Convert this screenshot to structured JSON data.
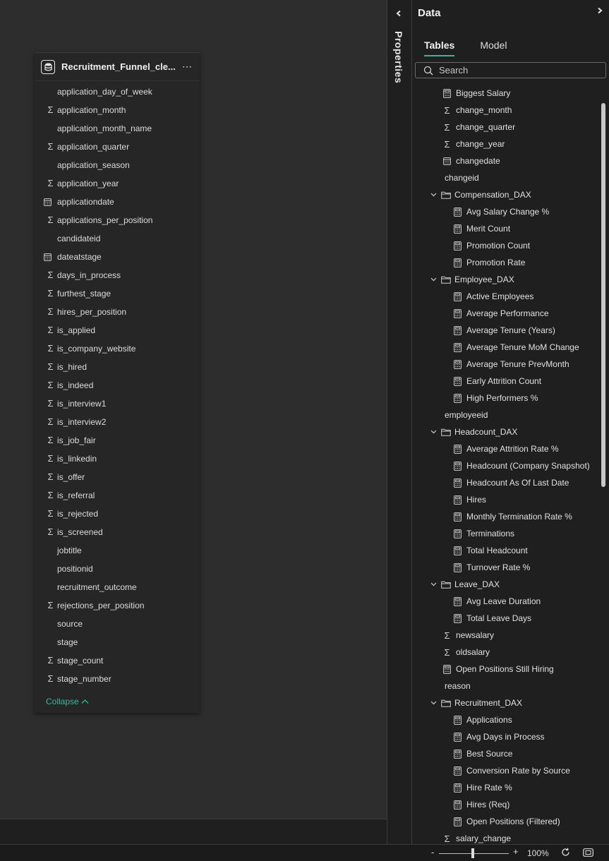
{
  "card": {
    "title": "Recruitment_Funnel_cle...",
    "more": "⋯",
    "collapse_label": "Collapse",
    "fields": [
      {
        "icon": "",
        "label": "application_day_of_week"
      },
      {
        "icon": "sigma",
        "label": "application_month"
      },
      {
        "icon": "",
        "label": "application_month_name"
      },
      {
        "icon": "sigma",
        "label": "application_quarter"
      },
      {
        "icon": "",
        "label": "application_season"
      },
      {
        "icon": "sigma",
        "label": "application_year"
      },
      {
        "icon": "calendar",
        "label": "applicationdate"
      },
      {
        "icon": "sigma",
        "label": "applications_per_position"
      },
      {
        "icon": "",
        "label": "candidateid"
      },
      {
        "icon": "calendar",
        "label": "dateatstage"
      },
      {
        "icon": "sigma",
        "label": "days_in_process"
      },
      {
        "icon": "sigma",
        "label": "furthest_stage"
      },
      {
        "icon": "sigma",
        "label": "hires_per_position"
      },
      {
        "icon": "sigma",
        "label": "is_applied"
      },
      {
        "icon": "sigma",
        "label": "is_company_website"
      },
      {
        "icon": "sigma",
        "label": "is_hired"
      },
      {
        "icon": "sigma",
        "label": "is_indeed"
      },
      {
        "icon": "sigma",
        "label": "is_interview1"
      },
      {
        "icon": "sigma",
        "label": "is_interview2"
      },
      {
        "icon": "sigma",
        "label": "is_job_fair"
      },
      {
        "icon": "sigma",
        "label": "is_linkedin"
      },
      {
        "icon": "sigma",
        "label": "is_offer"
      },
      {
        "icon": "sigma",
        "label": "is_referral"
      },
      {
        "icon": "sigma",
        "label": "is_rejected"
      },
      {
        "icon": "sigma",
        "label": "is_screened"
      },
      {
        "icon": "",
        "label": "jobtitle"
      },
      {
        "icon": "",
        "label": "positionid"
      },
      {
        "icon": "",
        "label": "recruitment_outcome"
      },
      {
        "icon": "sigma",
        "label": "rejections_per_position"
      },
      {
        "icon": "",
        "label": "source"
      },
      {
        "icon": "",
        "label": "stage"
      },
      {
        "icon": "sigma",
        "label": "stage_count"
      },
      {
        "icon": "sigma",
        "label": "stage_number"
      }
    ]
  },
  "properties": {
    "label": "Properties"
  },
  "data_pane": {
    "title": "Data",
    "tabs": [
      "Tables",
      "Model"
    ],
    "active_tab": "Tables",
    "search_placeholder": "Search",
    "tree": [
      {
        "level": 1,
        "folder": false,
        "icon": "calculator",
        "label": "Biggest Salary"
      },
      {
        "level": 1,
        "folder": false,
        "icon": "sigma",
        "label": "change_month"
      },
      {
        "level": 1,
        "folder": false,
        "icon": "sigma",
        "label": "change_quarter"
      },
      {
        "level": 1,
        "folder": false,
        "icon": "sigma",
        "label": "change_year"
      },
      {
        "level": 1,
        "folder": false,
        "icon": "calendar",
        "label": "changedate"
      },
      {
        "level": 1,
        "folder": false,
        "icon": "",
        "label": "changeid"
      },
      {
        "level": 1,
        "folder": true,
        "icon": "folder",
        "label": "Compensation_DAX"
      },
      {
        "level": 2,
        "folder": false,
        "icon": "calculator",
        "label": "Avg Salary Change %"
      },
      {
        "level": 2,
        "folder": false,
        "icon": "calculator",
        "label": "Merit Count"
      },
      {
        "level": 2,
        "folder": false,
        "icon": "calculator",
        "label": "Promotion Count"
      },
      {
        "level": 2,
        "folder": false,
        "icon": "calculator",
        "label": "Promotion Rate"
      },
      {
        "level": 1,
        "folder": true,
        "icon": "folder",
        "label": "Employee_DAX"
      },
      {
        "level": 2,
        "folder": false,
        "icon": "calculator",
        "label": "Active Employees"
      },
      {
        "level": 2,
        "folder": false,
        "icon": "calculator",
        "label": "Average Performance"
      },
      {
        "level": 2,
        "folder": false,
        "icon": "calculator",
        "label": "Average Tenure (Years)"
      },
      {
        "level": 2,
        "folder": false,
        "icon": "calculator",
        "label": "Average Tenure MoM Change"
      },
      {
        "level": 2,
        "folder": false,
        "icon": "calculator",
        "label": "Average Tenure PrevMonth"
      },
      {
        "level": 2,
        "folder": false,
        "icon": "calculator",
        "label": "Early Attrition Count"
      },
      {
        "level": 2,
        "folder": false,
        "icon": "calculator",
        "label": "High Performers %"
      },
      {
        "level": 1,
        "folder": false,
        "icon": "",
        "label": "employeeid"
      },
      {
        "level": 1,
        "folder": true,
        "icon": "folder",
        "label": "Headcount_DAX"
      },
      {
        "level": 2,
        "folder": false,
        "icon": "calculator",
        "label": "Average Attrition Rate %"
      },
      {
        "level": 2,
        "folder": false,
        "icon": "calculator",
        "label": "Headcount (Company Snapshot)"
      },
      {
        "level": 2,
        "folder": false,
        "icon": "calculator",
        "label": "Headcount As Of Last Date"
      },
      {
        "level": 2,
        "folder": false,
        "icon": "calculator",
        "label": "Hires"
      },
      {
        "level": 2,
        "folder": false,
        "icon": "calculator",
        "label": "Monthly Termination Rate %"
      },
      {
        "level": 2,
        "folder": false,
        "icon": "calculator",
        "label": "Terminations"
      },
      {
        "level": 2,
        "folder": false,
        "icon": "calculator",
        "label": "Total Headcount"
      },
      {
        "level": 2,
        "folder": false,
        "icon": "calculator",
        "label": "Turnover Rate %"
      },
      {
        "level": 1,
        "folder": true,
        "icon": "folder",
        "label": "Leave_DAX"
      },
      {
        "level": 2,
        "folder": false,
        "icon": "calculator",
        "label": "Avg Leave Duration"
      },
      {
        "level": 2,
        "folder": false,
        "icon": "calculator",
        "label": "Total Leave Days"
      },
      {
        "level": 1,
        "folder": false,
        "icon": "sigma",
        "label": "newsalary"
      },
      {
        "level": 1,
        "folder": false,
        "icon": "sigma",
        "label": "oldsalary"
      },
      {
        "level": 1,
        "folder": false,
        "icon": "calculator",
        "label": "Open Positions Still Hiring"
      },
      {
        "level": 1,
        "folder": false,
        "icon": "",
        "label": "reason"
      },
      {
        "level": 1,
        "folder": true,
        "icon": "folder",
        "label": "Recruitment_DAX"
      },
      {
        "level": 2,
        "folder": false,
        "icon": "calculator",
        "label": "Applications"
      },
      {
        "level": 2,
        "folder": false,
        "icon": "calculator",
        "label": "Avg Days in Process"
      },
      {
        "level": 2,
        "folder": false,
        "icon": "calculator",
        "label": "Best Source"
      },
      {
        "level": 2,
        "folder": false,
        "icon": "calculator",
        "label": "Conversion Rate by Source"
      },
      {
        "level": 2,
        "folder": false,
        "icon": "calculator",
        "label": "Hire Rate %"
      },
      {
        "level": 2,
        "folder": false,
        "icon": "calculator",
        "label": "Hires (Req)"
      },
      {
        "level": 2,
        "folder": false,
        "icon": "calculator",
        "label": "Open Positions (Filtered)"
      },
      {
        "level": 1,
        "folder": false,
        "icon": "sigma",
        "label": "salary_change"
      }
    ]
  },
  "status": {
    "zoom_minus": "-",
    "zoom_plus": "+",
    "zoom_level": "100%"
  },
  "colors": {
    "accent": "#3bb79a",
    "background": "#2d2d2d",
    "pane": "#1f1f1f"
  }
}
